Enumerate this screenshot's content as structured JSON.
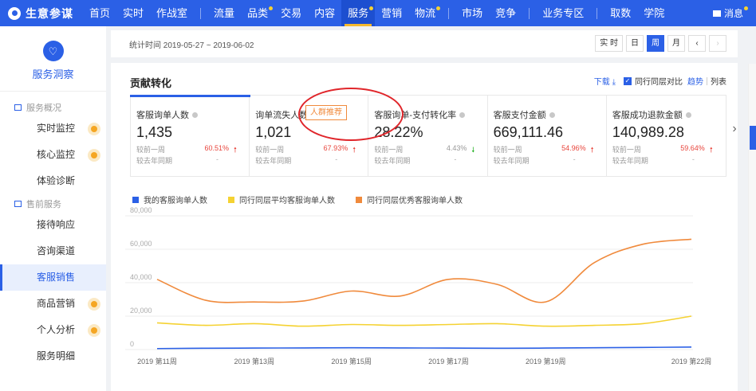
{
  "brand": {
    "name": "生意参谋"
  },
  "topnav": {
    "items": [
      {
        "label": "首页",
        "dot": false
      },
      {
        "label": "实时",
        "dot": false
      },
      {
        "label": "作战室",
        "dot": false
      },
      {
        "label": "流量",
        "dot": false
      },
      {
        "label": "品类",
        "dot": true
      },
      {
        "label": "交易",
        "dot": false
      },
      {
        "label": "内容",
        "dot": false
      },
      {
        "label": "服务",
        "dot": true,
        "active": true
      },
      {
        "label": "营销",
        "dot": false
      },
      {
        "label": "物流",
        "dot": true
      },
      {
        "label": "市场",
        "dot": false
      },
      {
        "label": "竞争",
        "dot": false
      },
      {
        "label": "业务专区",
        "dot": false
      },
      {
        "label": "取数",
        "dot": false
      },
      {
        "label": "学院",
        "dot": false
      }
    ],
    "message": "消息"
  },
  "sidebar": {
    "title": "服务洞察",
    "sections": [
      {
        "label": "服务概况",
        "items": [
          {
            "label": "实时监控",
            "dot": true
          },
          {
            "label": "核心监控",
            "dot": true
          },
          {
            "label": "体验诊断",
            "dot": false
          }
        ]
      },
      {
        "label": "售前服务",
        "items": [
          {
            "label": "接待响应",
            "dot": false
          },
          {
            "label": "咨询渠道",
            "dot": false
          },
          {
            "label": "客服销售",
            "dot": false,
            "active": true
          },
          {
            "label": "商品营销",
            "dot": true
          },
          {
            "label": "个人分析",
            "dot": true
          },
          {
            "label": "服务明细",
            "dot": false
          }
        ]
      }
    ]
  },
  "datebar": {
    "range": "统计时间 2019-05-27 ~ 2019-06-02",
    "periods": [
      "实 时",
      "日",
      "周",
      "月"
    ],
    "active_period": "周",
    "prev": "‹",
    "next": "›"
  },
  "card": {
    "title": "贡献转化",
    "download": "下载",
    "peer_compare": "同行同层对比",
    "trend": "趋势",
    "list": "列表",
    "tag": "人群推荐",
    "more": "›",
    "metrics": [
      {
        "label": "客服询单人数",
        "value": "1,435",
        "week_label": "较前一周",
        "week_value": "60.51%",
        "week_dir": "up",
        "year_label": "较去年同期",
        "year_value": "-"
      },
      {
        "label": "询单流失人数",
        "value": "1,021",
        "week_label": "较前一周",
        "week_value": "67.93%",
        "week_dir": "up",
        "year_label": "较去年同期",
        "year_value": "-"
      },
      {
        "label": "客服询单-支付转化率",
        "value": "28.22%",
        "week_label": "较前一周",
        "week_value": "4.43%",
        "week_dir": "down",
        "year_label": "较去年同期",
        "year_value": "-"
      },
      {
        "label": "客服支付金额",
        "value": "669,111.46",
        "week_label": "较前一周",
        "week_value": "54.96%",
        "week_dir": "up",
        "year_label": "较去年同期",
        "year_value": "-"
      },
      {
        "label": "客服成功退款金额",
        "value": "140,989.28",
        "week_label": "较前一周",
        "week_value": "59.64%",
        "week_dir": "up",
        "year_label": "较去年同期",
        "year_value": "-"
      }
    ]
  },
  "chart_data": {
    "type": "line",
    "x": [
      "2019 第11周",
      "2019 第12周",
      "2019 第13周",
      "2019 第14周",
      "2019 第15周",
      "2019 第16周",
      "2019 第17周",
      "2019 第18周",
      "2019 第19周",
      "2019 第20周",
      "2019 第21周",
      "2019 第22周"
    ],
    "x_tick_labels": [
      "2019 第11周",
      "2019 第13周",
      "2019 第15周",
      "2019 第17周",
      "2019 第19周",
      "2019 第22周"
    ],
    "y_ticks": [
      "0",
      "20,000",
      "40,000",
      "60,000",
      "80,000"
    ],
    "ylim": [
      0,
      80000
    ],
    "grid": true,
    "legend_position": "top-left",
    "series": [
      {
        "name": "我的客服询单人数",
        "color": "#2b60e6",
        "values": [
          600,
          800,
          900,
          1000,
          1100,
          1000,
          900,
          800,
          900,
          1100,
          1300,
          1500
        ]
      },
      {
        "name": "同行同层平均客服询单人数",
        "color": "#f5d232",
        "values": [
          16000,
          14500,
          15500,
          14000,
          15000,
          14500,
          15000,
          15500,
          14000,
          14500,
          15500,
          20000
        ]
      },
      {
        "name": "同行同层优秀客服询单人数",
        "color": "#f08a3c",
        "values": [
          42000,
          29500,
          28500,
          29000,
          35000,
          32000,
          42000,
          39000,
          28500,
          52000,
          63000,
          66000
        ]
      }
    ]
  }
}
